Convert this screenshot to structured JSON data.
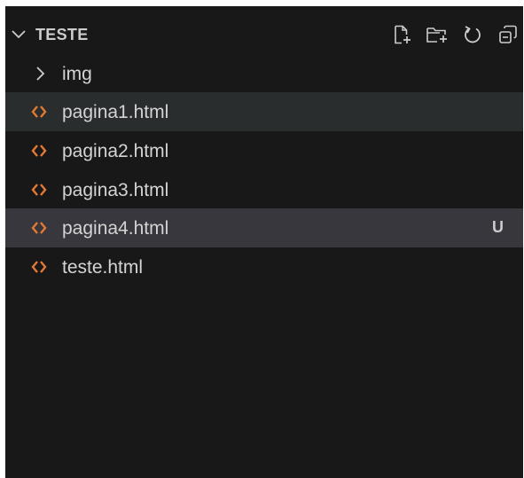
{
  "explorer": {
    "section_title": "TESTE",
    "actions": [
      {
        "name": "new-file-icon"
      },
      {
        "name": "new-folder-icon"
      },
      {
        "name": "refresh-icon"
      },
      {
        "name": "collapse-all-icon"
      }
    ],
    "items": [
      {
        "type": "folder",
        "label": "img",
        "icon": "chevron-right-icon"
      },
      {
        "type": "file",
        "label": "pagina1.html",
        "icon": "html-file-icon",
        "state": "hover"
      },
      {
        "type": "file",
        "label": "pagina2.html",
        "icon": "html-file-icon"
      },
      {
        "type": "file",
        "label": "pagina3.html",
        "icon": "html-file-icon"
      },
      {
        "type": "file",
        "label": "pagina4.html",
        "icon": "html-file-icon",
        "state": "selected",
        "badge": "U"
      },
      {
        "type": "file",
        "label": "teste.html",
        "icon": "html-file-icon"
      }
    ]
  },
  "colors": {
    "background": "#181818",
    "hover": "#2a2d2e",
    "selected": "#37373d",
    "html_icon": "#e37933",
    "text": "#cccccc"
  }
}
